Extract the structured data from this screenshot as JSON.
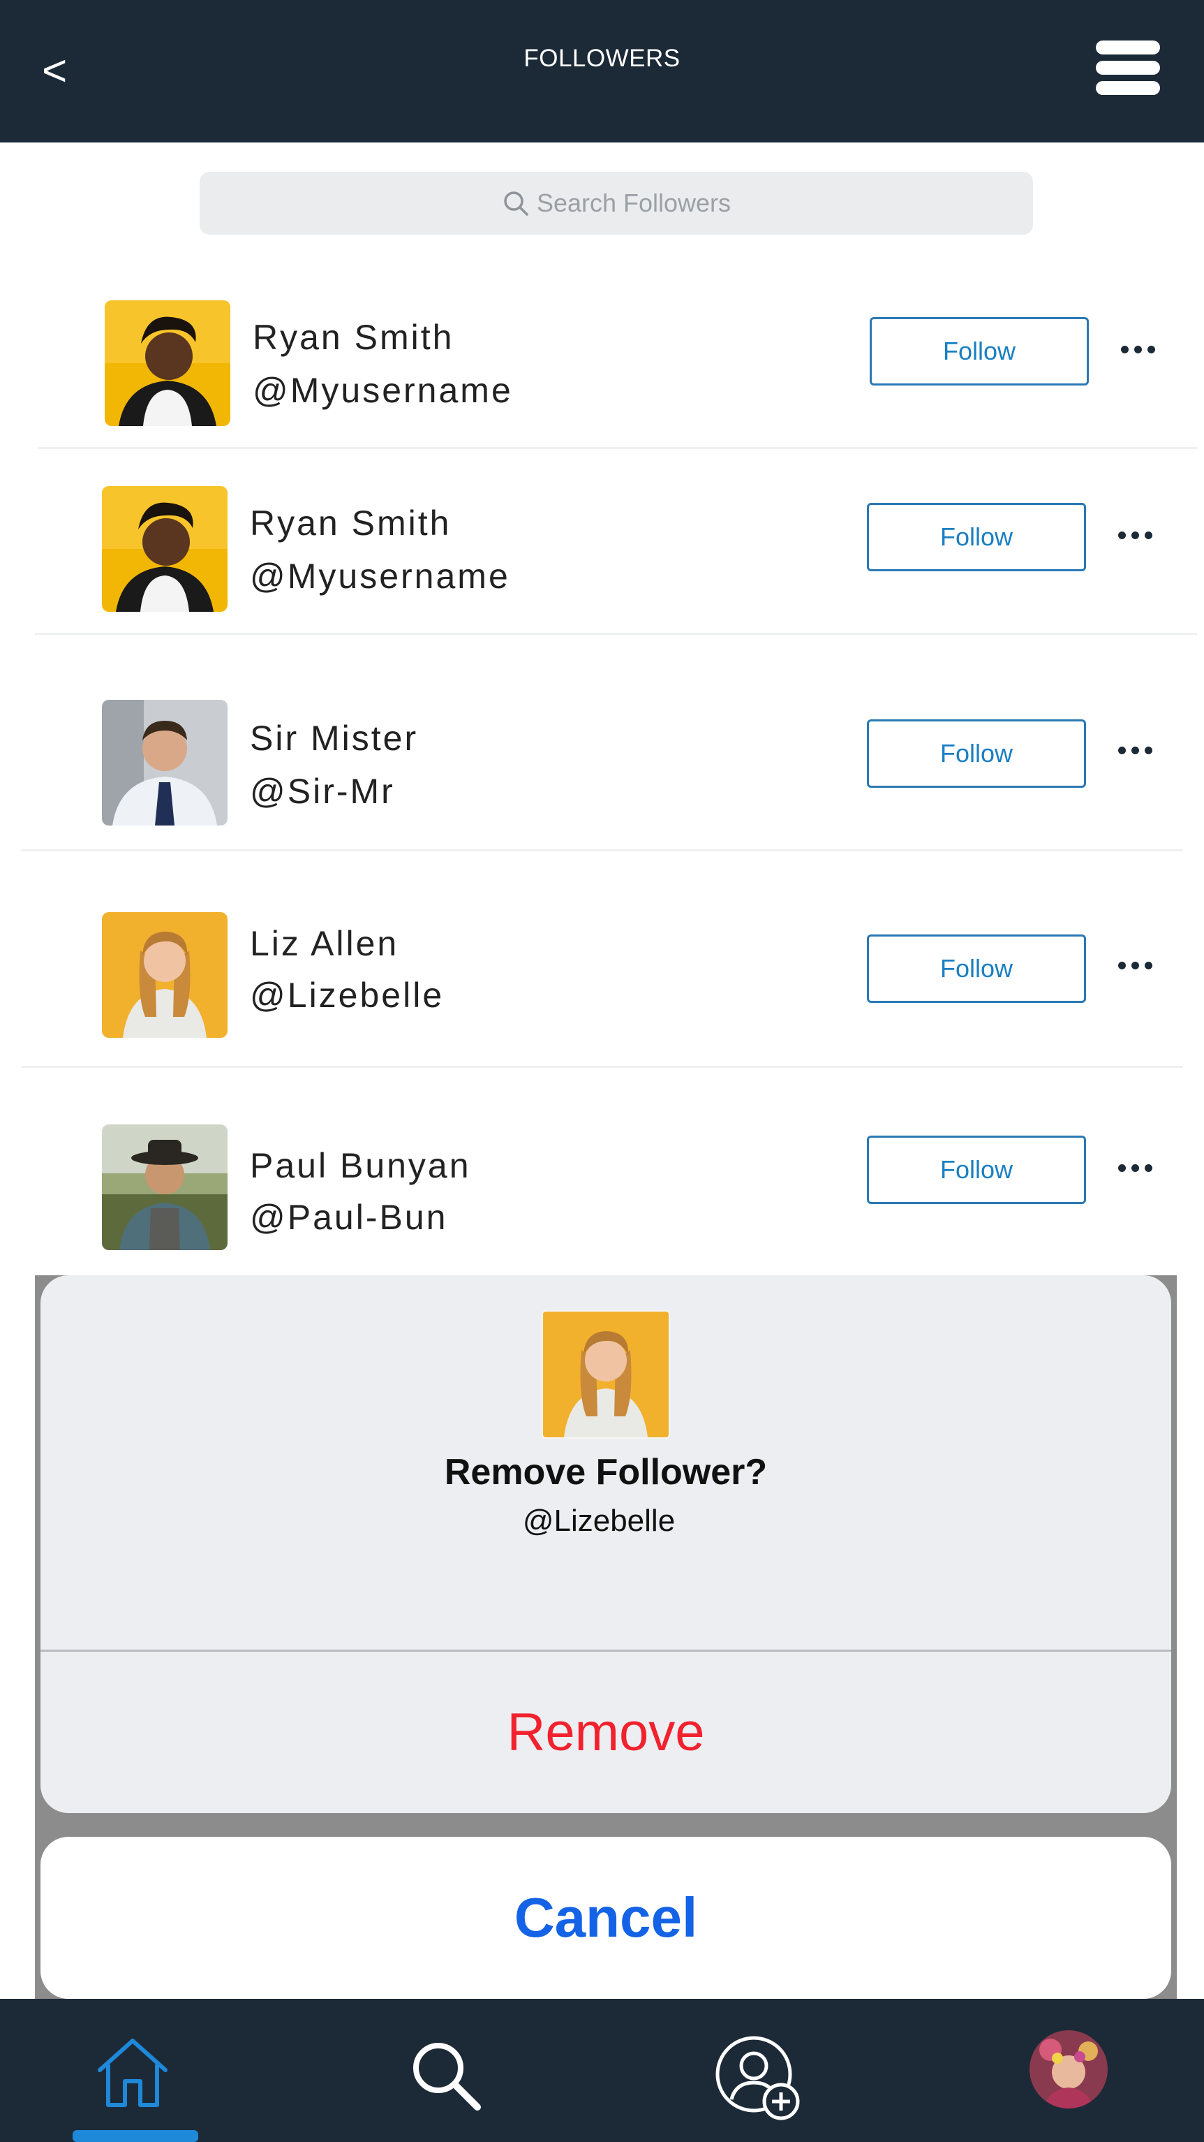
{
  "header": {
    "back_label": "<",
    "title": "FOLLOWERS"
  },
  "search": {
    "placeholder": "Search Followers"
  },
  "followers": [
    {
      "name": "Ryan Smith",
      "handle": "@Myusername",
      "follow_label": "Follow"
    },
    {
      "name": "Ryan Smith",
      "handle": "@Myusername",
      "follow_label": "Follow"
    },
    {
      "name": "Sir Mister",
      "handle": "@Sir-Mr",
      "follow_label": "Follow"
    },
    {
      "name": "Liz Allen",
      "handle": "@Lizebelle",
      "follow_label": "Follow"
    },
    {
      "name": "Paul Bunyan",
      "handle": "@Paul-Bun",
      "follow_label": "Follow"
    }
  ],
  "action_sheet": {
    "title": "Remove Follower?",
    "handle": "@Lizebelle",
    "remove_label": "Remove",
    "cancel_label": "Cancel"
  },
  "bottom_nav": {
    "items": [
      "home-icon",
      "search-icon",
      "add-user-icon",
      "profile-avatar"
    ],
    "active": "home-icon"
  },
  "colors": {
    "header_bg": "#1c2a37",
    "follow_blue": "#1a7fc2",
    "remove_red": "#f2212e",
    "cancel_blue": "#1463e6",
    "active_tab": "#1e88d9"
  }
}
